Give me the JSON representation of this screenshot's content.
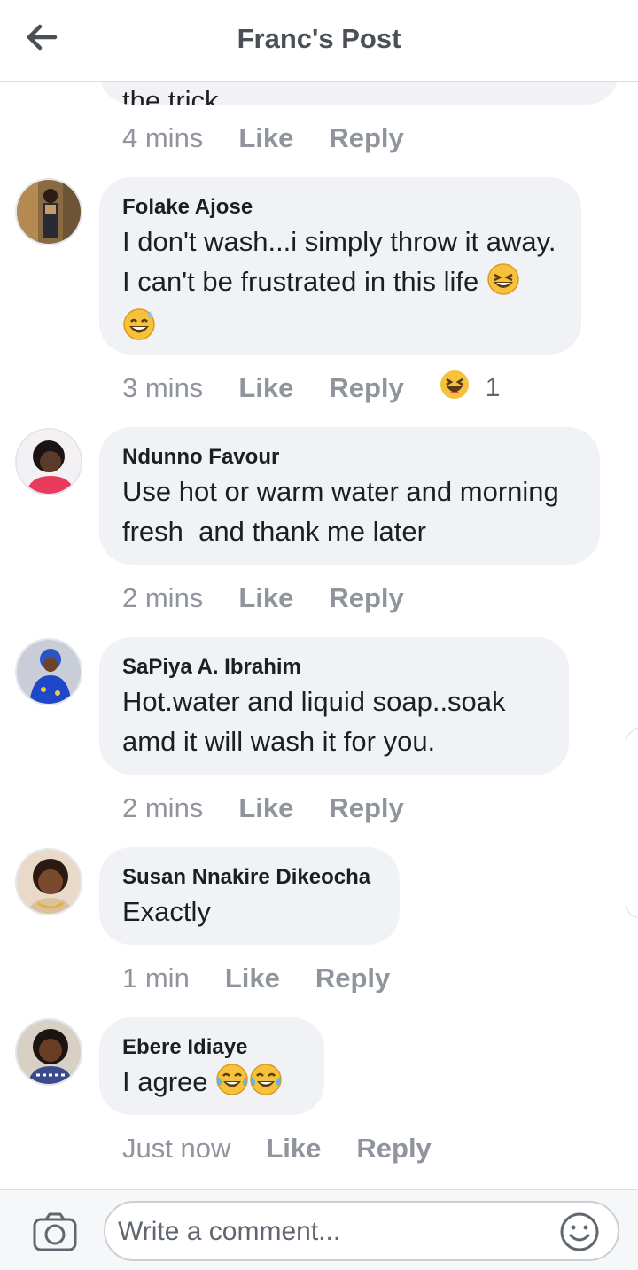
{
  "header": {
    "title": "Franc's Post"
  },
  "partial_comment": {
    "text": "the trick",
    "time": "4 mins",
    "like": "Like",
    "reply": "Reply"
  },
  "comments": [
    {
      "author": "Folake Ajose",
      "text": "I don't wash...i simply throw it away. I can't be frustrated in this life",
      "emojis": [
        "grinning-squinting-face",
        "grinning-sweat-face"
      ],
      "time": "3 mins",
      "like": "Like",
      "reply": "Reply",
      "reaction": "haha",
      "reaction_count": "1"
    },
    {
      "author": "Ndunno Favour",
      "text": "Use hot or warm water and morning fresh  and thank me later",
      "time": "2 mins",
      "like": "Like",
      "reply": "Reply"
    },
    {
      "author": "SaPiya A. Ibrahim",
      "text": "Hot.water and liquid soap..soak amd it will wash it for you.",
      "time": "2 mins",
      "like": "Like",
      "reply": "Reply"
    },
    {
      "author": "Susan Nnakire Dikeocha",
      "text": "Exactly",
      "time": "1 min",
      "like": "Like",
      "reply": "Reply"
    },
    {
      "author": "Ebere Idiaye",
      "text": "I agree",
      "emojis": [
        "tears-of-joy-face",
        "tears-of-joy-face"
      ],
      "time": "Just now",
      "like": "Like",
      "reply": "Reply"
    }
  ],
  "footer": {
    "placeholder": "Write a comment..."
  },
  "colors": {
    "meta_text": "#90949c",
    "bubble_bg": "#f0f2f5",
    "header_title": "#4b4f56",
    "emoji_yellow": "#f7c23b"
  }
}
